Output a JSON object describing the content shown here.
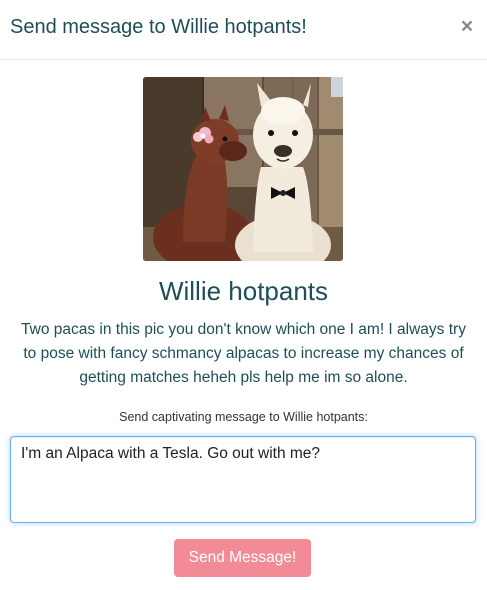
{
  "dialog": {
    "title": "Send message to Willie hotpants!",
    "close_glyph": "×"
  },
  "profile": {
    "photo_icon": "alpaca-photo",
    "name": "Willie hotpants",
    "bio": "Two pacas in this pic you don't know which one I am! I always try to pose with fancy schmancy alpacas to increase my chances of getting matches heheh pls help me im so alone."
  },
  "message": {
    "label": "Send captivating message to Willie hotpants:",
    "value": "I'm an Alpaca with a Tesla. Go out with me?"
  },
  "send_button": {
    "label": "Send Message!"
  },
  "colors": {
    "title_text": "#1f4e57",
    "button_bg": "#f28b96",
    "focus_border": "#66afe9"
  }
}
